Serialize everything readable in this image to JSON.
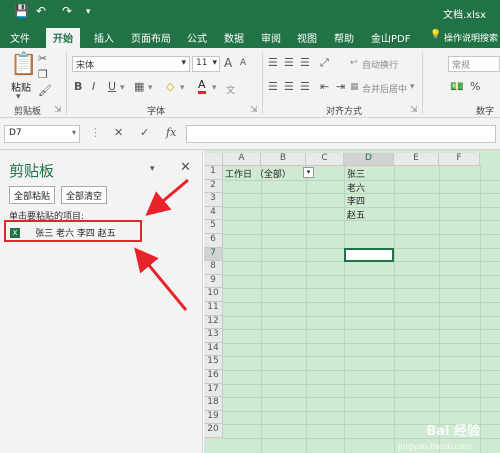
{
  "titlebar": {
    "doc_name": "文档.xlsx",
    "save_icon": "save-icon",
    "undo_icon": "undo-icon",
    "redo_icon": "redo-icon"
  },
  "menu": {
    "tabs": [
      "文件",
      "开始",
      "插入",
      "页面布局",
      "公式",
      "数据",
      "审阅",
      "视图",
      "帮助",
      "金山PDF",
      "操作说明搜索"
    ],
    "active": "开始"
  },
  "ribbon": {
    "paste_label": "粘贴",
    "clipboard_group": "剪贴板",
    "font_name": "宋体",
    "font_size": "11",
    "font_group": "字体",
    "wrap_text": "自动换行",
    "merge_center": "合并后居中",
    "align_group": "对齐方式",
    "number_format": "常规",
    "number_group": "数字",
    "bold": "B",
    "italic": "I",
    "underline": "U",
    "grow_font": "A",
    "shrink_font": "A"
  },
  "formula_bar": {
    "name_box": "D7",
    "fx": "fx",
    "cancel": "✕",
    "enter": "✓"
  },
  "clipboard_pane": {
    "title": "剪贴板",
    "paste_all": "全部粘贴",
    "clear_all": "全部清空",
    "hint": "单击要粘贴的项目:",
    "items": [
      {
        "text": "张三 老六 李四 赵五"
      }
    ]
  },
  "sheet": {
    "columns": [
      "A",
      "B",
      "C",
      "D",
      "E",
      "F"
    ],
    "rows": [
      "1",
      "2",
      "3",
      "4",
      "5",
      "6",
      "7",
      "8",
      "9",
      "10",
      "11",
      "12",
      "13",
      "14",
      "15",
      "16",
      "17",
      "18",
      "19",
      "20"
    ],
    "filter_cell": "工作日 （全部）",
    "d_values": [
      "张三",
      "老六",
      "李四",
      "赵五"
    ],
    "selected_cell": "D7"
  },
  "watermark": {
    "main": "Bai 经验",
    "sub": "jingyan.baidu.com"
  },
  "colors": {
    "accent": "#217346",
    "highlight": "#e8242a",
    "grid_bg": "#cfe9d3"
  }
}
